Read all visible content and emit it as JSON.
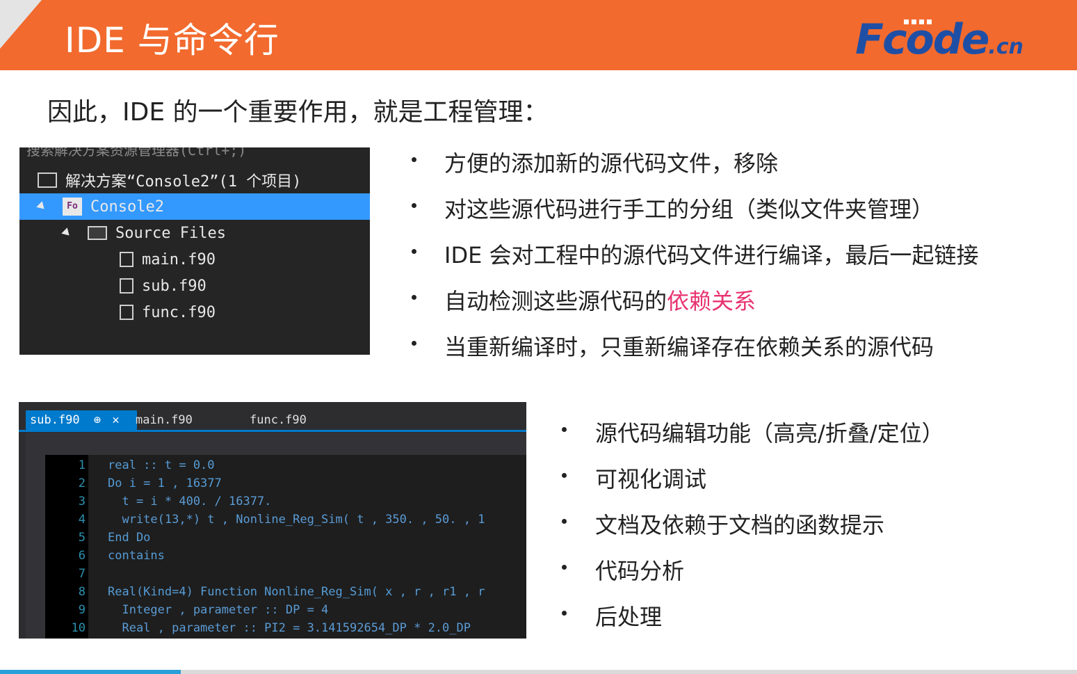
{
  "header": {
    "title": "IDE 与命令行",
    "logo_big": "Fcode",
    "logo_small": ".cn"
  },
  "heading": "因此，IDE 的一个重要作用，就是工程管理：",
  "solution_explorer": {
    "cut_text": "搜索解决方案资源管理器(Ctrl+;)",
    "solution_label": "解决方案“Console2”(1 个项目)",
    "project_icon_text": "Fo",
    "project_label": "Console2",
    "folder_label": "Source Files",
    "files": [
      "main.f90",
      "sub.f90",
      "func.f90"
    ]
  },
  "bullets_top": [
    "方便的添加新的源代码文件，移除",
    "对这些源代码进行手工的分组（类似文件夹管理）",
    "IDE 会对工程中的源代码文件进行编译，最后一起链接",
    "自动检测这些源代码的",
    "当重新编译时，只重新编译存在依赖关系的源代码"
  ],
  "bullet_highlight": "依赖关系",
  "bullets_bottom": [
    "源代码编辑功能（高亮/折叠/定位）",
    "可视化调试",
    "文档及依赖于文档的函数提示",
    "代码分析",
    "后处理"
  ],
  "editor": {
    "tabs": [
      "sub.f90",
      "main.f90",
      "func.f90"
    ],
    "pin_icon_text": "⊕",
    "close_icon_text": "✕",
    "line_numbers": [
      "1",
      "2",
      "3",
      "4",
      "5",
      "6",
      "7",
      "8",
      "9",
      "10"
    ],
    "code_lines": [
      "real :: t = 0.0",
      "Do i = 1 , 16377",
      "  t = i * 400. / 16377.",
      "  write(13,*) t , Nonline_Reg_Sim( t , 350. , 50. , 1",
      "End Do",
      "contains",
      "",
      "Real(Kind=4) Function Nonline_Reg_Sim( x , r , r1 , r",
      "  Integer , parameter :: DP = 4",
      "  Real , parameter :: PI2 = 3.141592654_DP * 2.0_DP"
    ]
  },
  "colors": {
    "header_bg": "#f26a2e",
    "logo": "#1f4fa5",
    "highlight": "#e8336f",
    "selection": "#3399ff",
    "tab_active": "#007acc"
  }
}
